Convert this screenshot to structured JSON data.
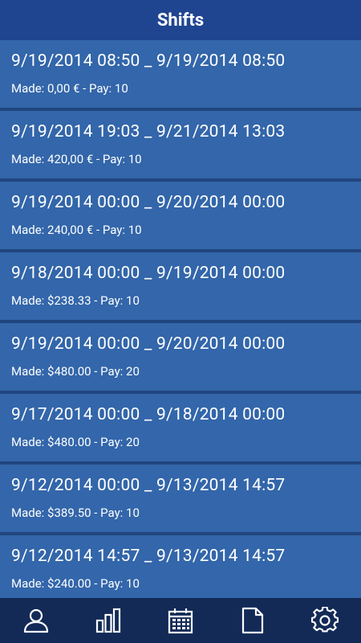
{
  "header": {
    "title": "Shifts"
  },
  "shifts": [
    {
      "range": "9/19/2014 08:50 _ 9/19/2014 08:50",
      "meta": "Made: 0,00 € - Pay: 10"
    },
    {
      "range": "9/19/2014 19:03 _ 9/21/2014 13:03",
      "meta": "Made: 420,00 € - Pay: 10"
    },
    {
      "range": "9/19/2014 00:00 _ 9/20/2014 00:00",
      "meta": "Made: 240,00 € - Pay: 10"
    },
    {
      "range": "9/18/2014 00:00 _ 9/19/2014 00:00",
      "meta": "Made: $238.33 - Pay: 10"
    },
    {
      "range": "9/19/2014 00:00 _ 9/20/2014 00:00",
      "meta": "Made: $480.00 - Pay: 20"
    },
    {
      "range": "9/17/2014 00:00 _ 9/18/2014 00:00",
      "meta": "Made: $480.00 - Pay: 20"
    },
    {
      "range": "9/12/2014 00:00 _ 9/13/2014 14:57",
      "meta": "Made: $389.50 - Pay: 10"
    },
    {
      "range": "9/12/2014 14:57 _ 9/13/2014 14:57",
      "meta": "Made: $240.00 - Pay: 10"
    }
  ],
  "tabbar": {
    "icons": [
      "user-icon",
      "bar-chart-icon",
      "calendar-icon",
      "document-icon",
      "settings-gear-icon"
    ]
  },
  "colors": {
    "header_bg": "#1f4590",
    "row_bg": "#3366aa",
    "row_divider": "#21457f",
    "tabbar_bg": "#132a57",
    "text": "#ffffff"
  }
}
